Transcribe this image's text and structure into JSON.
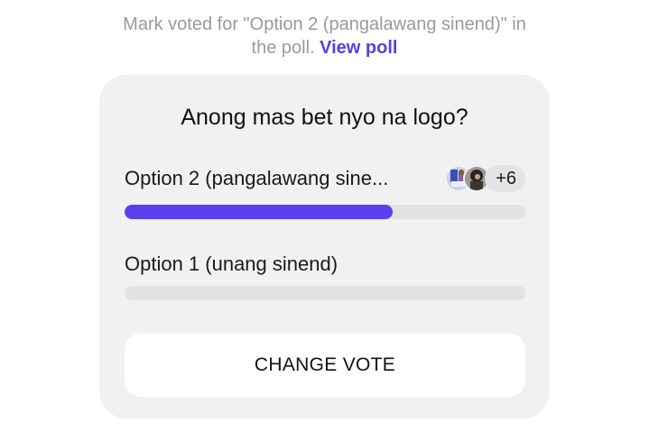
{
  "notice": {
    "line1": "Mark voted for \"Option 2 (pangalawang sinend)\" in",
    "line2": "the poll.",
    "link": "View poll"
  },
  "poll": {
    "question": "Anong mas bet nyo na logo?",
    "options": [
      {
        "label": "Option 2 (pangalawang sine...",
        "progress_fraction": 0.67,
        "voter_avatars": [
          "avatar-photo-1",
          "avatar-photo-2"
        ],
        "extra_voters": "+6",
        "bar_color": "#5b3fee"
      },
      {
        "label": "Option 1 (unang sinend)",
        "progress_fraction": 0
      }
    ],
    "change_vote_label": "CHANGE VOTE"
  },
  "colors": {
    "accent": "#5b3fee",
    "link": "#5b3fe0",
    "card_background": "#f1f1f1",
    "track": "#e2e2e2"
  }
}
